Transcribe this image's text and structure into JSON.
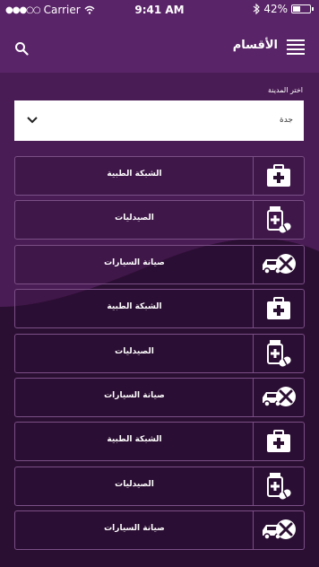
{
  "status_bar": {
    "carrier": "Carrier",
    "time": "9:41 AM",
    "battery": "42%",
    "battery_level": 0.42
  },
  "header": {
    "title": "الأقسام",
    "menu_icon": "menu-icon",
    "search_icon": "search-icon"
  },
  "city_picker": {
    "label": "اختر المدينة",
    "value": "جدة",
    "icon": "chevron-down-icon"
  },
  "categories": [
    {
      "label": "الشبكة الطبية",
      "icon": "medical-kit-icon"
    },
    {
      "label": "الصيدليات",
      "icon": "pharmacy-icon"
    },
    {
      "label": "صيانة السيارات",
      "icon": "car-repair-icon"
    },
    {
      "label": "الشبكة الطبية",
      "icon": "medical-kit-icon"
    },
    {
      "label": "الصيدليات",
      "icon": "pharmacy-icon"
    },
    {
      "label": "صيانة السيارات",
      "icon": "car-repair-icon"
    },
    {
      "label": "الشبكة الطبية",
      "icon": "medical-kit-icon"
    },
    {
      "label": "الصيدليات",
      "icon": "pharmacy-icon"
    },
    {
      "label": "صيانة السيارات",
      "icon": "car-repair-icon"
    }
  ],
  "colors": {
    "header_bg": "#5a2468",
    "page_bg": "#2b0f33",
    "border": "#7a4f86"
  }
}
